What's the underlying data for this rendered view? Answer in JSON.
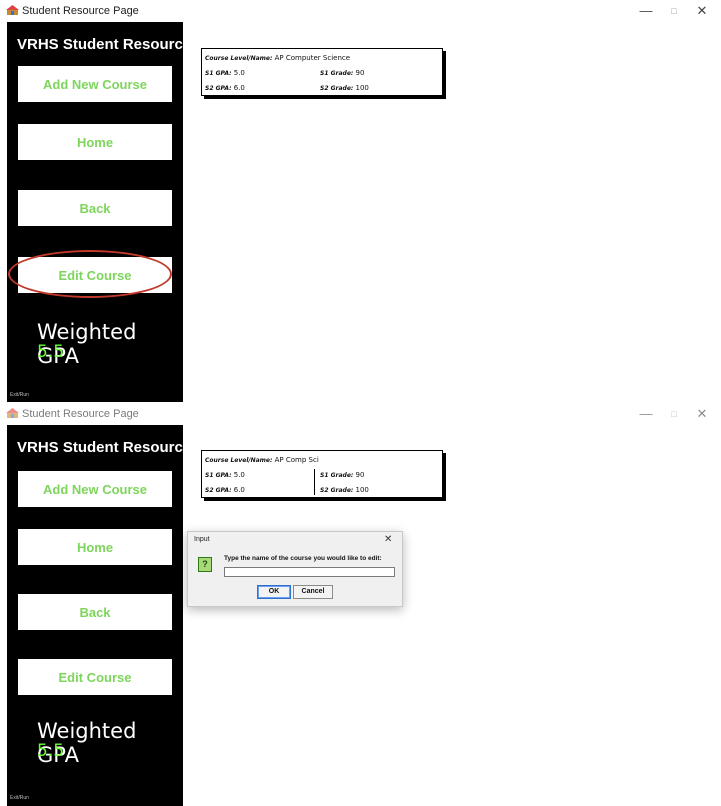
{
  "colors": {
    "sidebar_bg": "#000000",
    "button_text": "#7ed55c",
    "gpa_value": "#66ff33",
    "highlight": "#c0392b",
    "dialog_icon": "#a8d878"
  },
  "icons": {
    "window_icon": "student-app-icon",
    "minimize": "minimize-icon",
    "maximize": "maximize-icon",
    "close": "close-icon",
    "dialog_icon": "question-icon"
  },
  "window": {
    "title": "Student Resource Page",
    "minimize": "—",
    "maximize": "□",
    "close": "✕"
  },
  "sidebar": {
    "title": "VRHS Student Resources Page",
    "buttons": [
      "Add New Course",
      "Home",
      "Back",
      "Edit Course"
    ],
    "gpa_label": "Weighted GPA",
    "gpa_value": "5.5",
    "footer_note": "Exit/Run"
  },
  "screen1": {
    "course": {
      "level_label": "Course Level/Name:",
      "name": "AP Computer Science",
      "s1_gpa_label": "S1 GPA:",
      "s1_gpa": "5.0",
      "s2_gpa_label": "S2 GPA:",
      "s2_gpa": "6.0",
      "s1_grade_label": "S1 Grade:",
      "s1_grade": "90",
      "s2_grade_label": "S2 Grade:",
      "s2_grade": "100"
    }
  },
  "screen2": {
    "course": {
      "level_label": "Course Level/Name:",
      "name": "AP Comp Sci",
      "s1_gpa_label": "S1 GPA:",
      "s1_gpa": "5.0",
      "s2_gpa_label": "S2 GPA:",
      "s2_gpa": "6.0",
      "s1_grade_label": "S1 Grade:",
      "s1_grade": "90",
      "s2_grade_label": "S2 Grade:",
      "s2_grade": "100"
    },
    "dialog": {
      "title": "Input",
      "close": "✕",
      "icon_glyph": "?",
      "message": "Type the name of the course you would like to edit:",
      "input_value": "",
      "ok_label": "OK",
      "cancel_label": "Cancel"
    }
  }
}
